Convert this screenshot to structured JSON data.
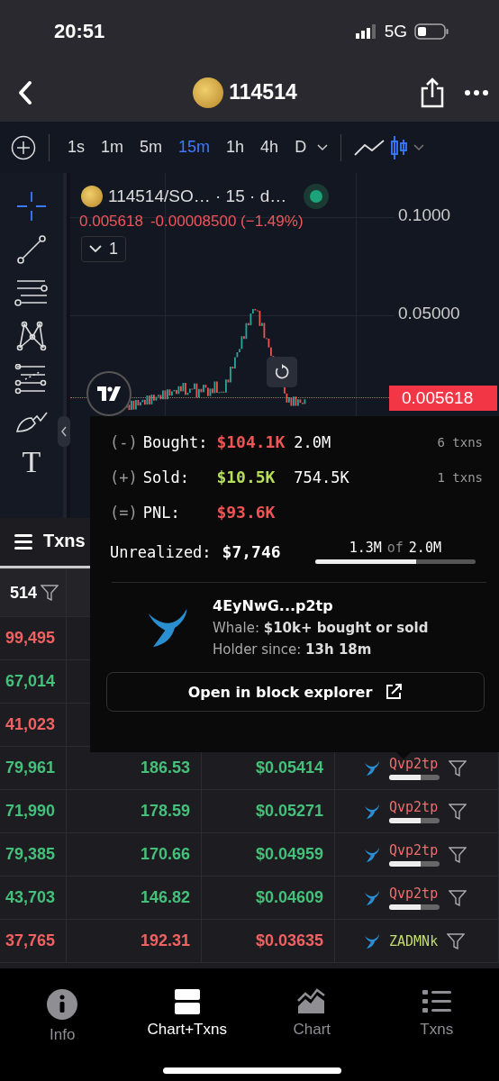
{
  "status_bar": {
    "time": "20:51",
    "network": "5G"
  },
  "header": {
    "title": "114514"
  },
  "timeframes": [
    {
      "label": "1s",
      "selected": false
    },
    {
      "label": "1m",
      "selected": false
    },
    {
      "label": "5m",
      "selected": false
    },
    {
      "label": "15m",
      "selected": true
    },
    {
      "label": "1h",
      "selected": false
    },
    {
      "label": "4h",
      "selected": false
    },
    {
      "label": "D",
      "selected": false
    }
  ],
  "chart_styles": [
    {
      "kind": "line",
      "selected": false
    },
    {
      "kind": "candles",
      "selected": true
    }
  ],
  "drawing_tools": [
    {
      "kind": "crosshair",
      "selected": true
    },
    {
      "kind": "trendline",
      "selected": false
    },
    {
      "kind": "channel",
      "selected": false
    },
    {
      "kind": "pattern",
      "selected": false
    },
    {
      "kind": "fib",
      "selected": false
    },
    {
      "kind": "brush",
      "selected": false
    },
    {
      "kind": "text",
      "label": "T",
      "selected": false
    }
  ],
  "chart": {
    "legend": "114514/SO… · 15 · d…",
    "live": true,
    "last": "0.005618",
    "change": "-0.00008500 (−1.49%)",
    "indicators": "1",
    "price_axis": [
      "0.1000",
      "0.05000"
    ],
    "price_tag": "0.005618"
  },
  "txns_tab": {
    "label": "Txns"
  },
  "table": {
    "header": "514",
    "rows": [
      {
        "color": "#f06262",
        "amount": "99,495"
      },
      {
        "color": "#45c07a",
        "amount": "67,014"
      },
      {
        "color": "#f06262",
        "amount": "41,023"
      },
      {
        "color": "#45c07a",
        "amount": "79,961",
        "total": "186.53",
        "price": "$0.05414",
        "trader": {
          "name": "Qvp2tp",
          "color": "#f26d6d",
          "level": 0.63
        }
      },
      {
        "color": "#45c07a",
        "amount": "71,990",
        "total": "178.59",
        "price": "$0.05271",
        "trader": {
          "name": "Qvp2tp",
          "color": "#f26d6d",
          "level": 0.63
        }
      },
      {
        "color": "#45c07a",
        "amount": "79,385",
        "total": "170.66",
        "price": "$0.04959",
        "trader": {
          "name": "Qvp2tp",
          "color": "#f26d6d",
          "level": 0.63
        }
      },
      {
        "color": "#45c07a",
        "amount": "43,703",
        "total": "146.82",
        "price": "$0.04609",
        "trader": {
          "name": "Qvp2tp",
          "color": "#f26d6d",
          "level": 0.63
        }
      },
      {
        "color": "#f06262",
        "amount": "37,765",
        "total": "192.31",
        "price": "$0.03635",
        "trader": {
          "name": "ZADMNk",
          "color": "#c3dc6e"
        }
      }
    ]
  },
  "popover": {
    "stats": [
      {
        "sign": "(-)",
        "label": "Bought:",
        "value": "$104.1K",
        "color": "#f05454",
        "amount": "2.0M",
        "txns": "6 txns"
      },
      {
        "sign": "(+)",
        "label": "Sold:",
        "value": "$10.5K",
        "color": "#b7dd5c",
        "amount": "754.5K",
        "txns": "1 txns"
      },
      {
        "sign": "(=)",
        "label": "PNL:",
        "value": "$93.6K",
        "color": "#f05454"
      }
    ],
    "unrealized": {
      "label": "Unrealized:",
      "value": "$7,746",
      "held": "1.3M",
      "of": "of",
      "total": "2.0M",
      "level": 0.63
    },
    "wallet": {
      "address": "4EyNwG...p2tp",
      "tag": "Whale: **$10k+ bought or sold**",
      "since": "Holder since: **13h 18m**"
    },
    "button": "Open in block explorer"
  },
  "tabbar": [
    {
      "kind": "info",
      "label": "Info",
      "selected": false
    },
    {
      "kind": "split",
      "label": "Chart+Txns",
      "selected": true
    },
    {
      "kind": "chart",
      "label": "Chart",
      "selected": false
    },
    {
      "kind": "list",
      "label": "Txns",
      "selected": false
    }
  ]
}
